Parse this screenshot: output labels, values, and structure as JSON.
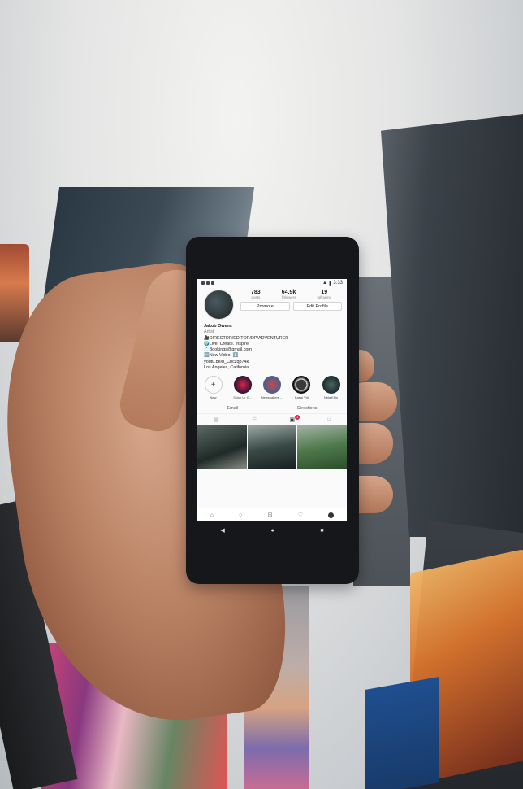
{
  "status_bar": {
    "time": "3:33"
  },
  "profile": {
    "stats": [
      {
        "value": "783",
        "label": "posts"
      },
      {
        "value": "64.9k",
        "label": "followers"
      },
      {
        "value": "19",
        "label": "following"
      }
    ],
    "promote_label": "Promote",
    "edit_profile_label": "Edit Profile",
    "name": "Jakob Owens",
    "category": "Artist",
    "bio_lines": [
      "🎥DIRECTOR/EDITOR/DP/ADVENTURER",
      "🌍Live. Create. Inspire.",
      "📩Bookings@gmail.com",
      "🆕New Video! ⬇️",
      "youtu.be/b_Cbczqp74k",
      "Los Angeles, California"
    ]
  },
  "highlights": [
    {
      "label": "New",
      "icon": "plus-icon"
    },
    {
      "label": "Scion Ur G..."
    },
    {
      "label": "Newsoakers ..."
    },
    {
      "label": "Kasai Ytti"
    },
    {
      "label": "Nbla Ebip"
    }
  ],
  "actions": {
    "email": "Email",
    "directions": "Directions"
  },
  "tabs": {
    "notification_count": "1"
  },
  "nav_icons": [
    "home-icon",
    "search-icon",
    "add-icon",
    "heart-icon",
    "profile-icon"
  ],
  "soft_keys": {
    "back": "◀",
    "home": "●",
    "recent": "■"
  },
  "colors": {
    "badge": "#e0254b",
    "phone_body": "#15171a"
  }
}
